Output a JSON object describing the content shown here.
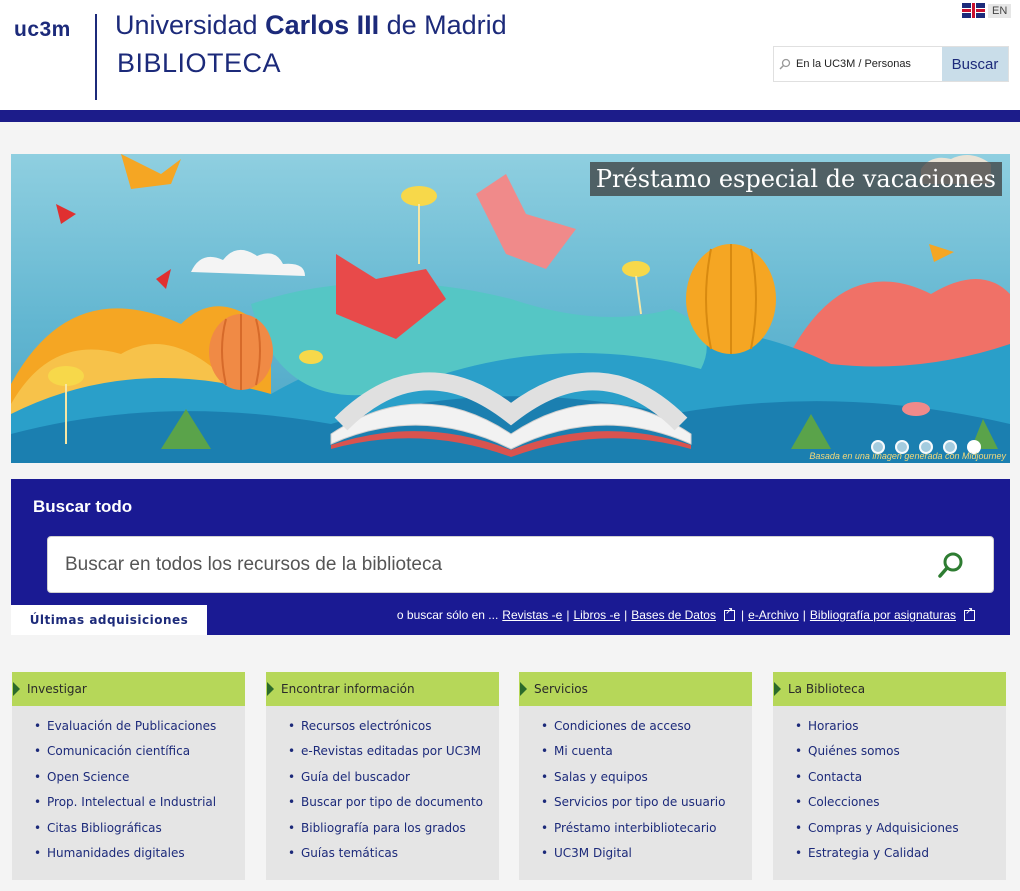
{
  "header": {
    "logo": "uc3m",
    "university_pre": "Universidad ",
    "university_bold": "Carlos III",
    "university_post": " de Madrid",
    "section": "BIBLIOTECA",
    "lang_label": "EN",
    "site_search_placeholder": "En la UC3M / Personas",
    "site_search_button": "Buscar"
  },
  "banner": {
    "caption": "Préstamo especial de vacaciones",
    "credit": "Basada en una imagen generada con Midjourney",
    "slides_count": 5,
    "active_slide": 5
  },
  "search": {
    "title": "Buscar todo",
    "placeholder": "Buscar en todos los recursos de la biblioteca",
    "tab_label": "Últimas adquisiciones",
    "also_prefix": "o buscar sólo en ...",
    "links": [
      "Revistas -e",
      "Libros -e",
      "Bases de Datos",
      "e-Archivo",
      "Bibliografía por asignaturas"
    ]
  },
  "columns": [
    {
      "title": "Investigar",
      "items": [
        "Evaluación de Publicaciones",
        "Comunicación científica",
        "Open Science",
        "Prop. Intelectual e Industrial",
        "Citas Bibliográficas",
        "Humanidades digitales"
      ]
    },
    {
      "title": "Encontrar información",
      "items": [
        "Recursos electrónicos",
        "e-Revistas editadas por UC3M",
        "Guía del buscador",
        "Buscar por tipo de documento",
        "Bibliografía para los grados",
        "Guías temáticas"
      ]
    },
    {
      "title": "Servicios",
      "items": [
        "Condiciones de acceso",
        "Mi cuenta",
        "Salas y equipos",
        "Servicios por tipo de usuario",
        "Préstamo interbibliotecario",
        "UC3M Digital"
      ]
    },
    {
      "title": "La Biblioteca",
      "items": [
        "Horarios",
        "Quiénes somos",
        "Contacta",
        "Colecciones",
        "Compras y Adquisiciones",
        "Estrategia y Calidad"
      ]
    }
  ],
  "colors": {
    "brand_navy": "#1c2a7a",
    "bar_blue": "#1c1c8a",
    "search_blue": "#1a1a93",
    "menu_green": "#b6d759",
    "search_icon_green": "#2e7d32"
  }
}
